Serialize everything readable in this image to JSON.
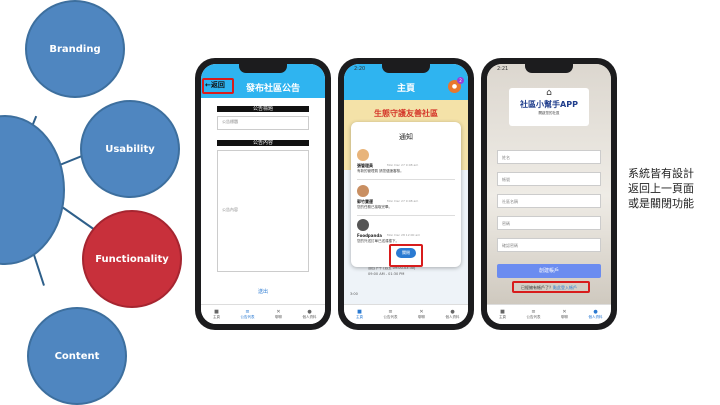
{
  "concepts": {
    "branding": "Branding",
    "usability": "Usability",
    "functionality": "Functionality",
    "content": "Content"
  },
  "phone1": {
    "back": "返回",
    "title": "發布社區公告",
    "title_label": "公告標題",
    "title_placeholder": "公告標題",
    "content_label": "公告內容",
    "content_placeholder": "公告內容",
    "submit": "送出"
  },
  "phone2": {
    "time": "2:20",
    "title": "主頁",
    "badge": "2",
    "banner": "生態守護友善社區",
    "dialog_title": "通知",
    "notices": [
      {
        "name": "張管理員",
        "time": "Mon Dec 27 9:08 am",
        "msg": "有新的管理員 請您儘速審核。"
      },
      {
        "name": "郭竹寶運",
        "time": "Mon Dec 27 9:08 am",
        "msg": "您的任務已接取完畢。"
      },
      {
        "name": "Foodpanda",
        "time": "Mon Dec 28 12:00 am",
        "msg": "您的外送訂單已送達樓下。"
      }
    ],
    "confirm": "關閉",
    "bg_text": "週四下午 (週五 09:00-03:30)",
    "bg_text2": "09:00 AM - 01:30 PM",
    "bg_time": "3:00"
  },
  "phone3": {
    "time": "2:21",
    "app_name": "社區小幫手APP",
    "subtitle": "開啟您的社區",
    "f1": "姓名",
    "f2": "帳號",
    "f3": "社區名稱",
    "f4": "密碼",
    "f5": "確認密碼",
    "register": "創建帳戶",
    "login_prompt": "已經擁有帳戶了？",
    "login_link": "點此登入帳戶"
  },
  "tabs": [
    "主頁",
    "公告列表",
    "聊聊",
    "個人資料"
  ],
  "side_text": [
    "系統皆有設計",
    "返回上一頁面",
    "或是關閉功能"
  ]
}
